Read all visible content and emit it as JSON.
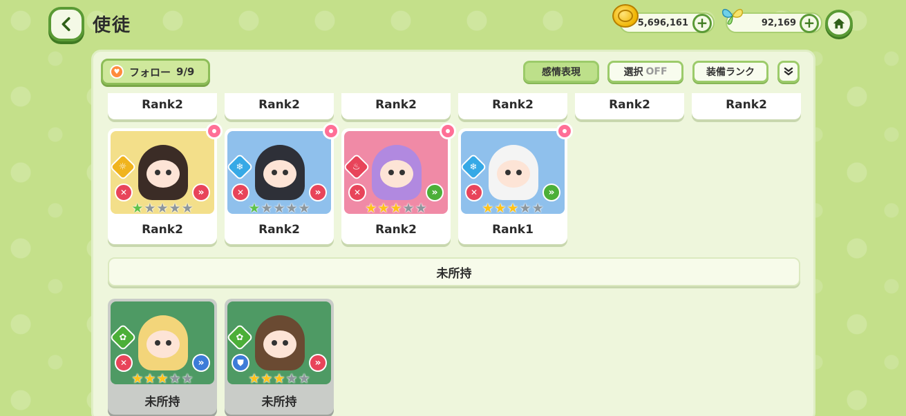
{
  "header": {
    "title": "使徒",
    "coins": "5,696,161",
    "gems": "92,169",
    "plus": "+"
  },
  "toolbar": {
    "follow_label": "フォロー",
    "follow_count": "9/9",
    "emotion_label": "感情表現",
    "select_label": "選択",
    "select_state": "OFF",
    "equip_rank_label": "装備ランク"
  },
  "top_row_ranks": [
    "Rank2",
    "Rank2",
    "Rank2",
    "Rank2",
    "Rank2",
    "Rank2"
  ],
  "owned_cards": [
    {
      "rank": "Rank2",
      "bg": "#f3df8a",
      "hair": "#3b2c26",
      "element": "sun",
      "element_color": "#f0b41e",
      "element_glyph": "☼",
      "role_color": "#e8445a",
      "role_glyph": "✕",
      "pos_color": "#e8445a",
      "pos_glyph": "»",
      "stars_filled": 1,
      "star_color": "green"
    },
    {
      "rank": "Rank2",
      "bg": "#8fc0ec",
      "hair": "#2e3038",
      "element": "ice",
      "element_color": "#36a9e6",
      "element_glyph": "❄",
      "role_color": "#e8445a",
      "role_glyph": "✕",
      "pos_color": "#e8445a",
      "pos_glyph": "»",
      "stars_filled": 1,
      "star_color": "green"
    },
    {
      "rank": "Rank2",
      "bg": "#f08aa6",
      "hair": "#b189e0",
      "element": "fire",
      "element_color": "#e8445a",
      "element_glyph": "♨",
      "role_color": "#e8445a",
      "role_glyph": "✕",
      "pos_color": "#4caf38",
      "pos_glyph": "»",
      "stars_filled": 3,
      "star_color": "gold"
    },
    {
      "rank": "Rank1",
      "bg": "#8fc0ec",
      "hair": "#f4f4f4",
      "element": "ice",
      "element_color": "#36a9e6",
      "element_glyph": "❄",
      "role_color": "#e8445a",
      "role_glyph": "✕",
      "pos_color": "#4caf38",
      "pos_glyph": "»",
      "stars_filled": 3,
      "star_color": "gold"
    }
  ],
  "unowned_label": "未所持",
  "unowned_cards": [
    {
      "label": "未所持",
      "hair": "#f3d57a",
      "element_color": "#4caf38",
      "element_glyph": "✿",
      "role_color": "#e8445a",
      "role_glyph": "✕",
      "pos_color": "#3d7cd8",
      "pos_glyph": "»",
      "stars_filled": 3
    },
    {
      "label": "未所持",
      "hair": "#6a4a32",
      "element_color": "#4caf38",
      "element_glyph": "✿",
      "role_color": "#3d7cd8",
      "role_glyph": "⛊",
      "pos_color": "#e8445a",
      "pos_glyph": "»",
      "stars_filled": 3
    }
  ]
}
